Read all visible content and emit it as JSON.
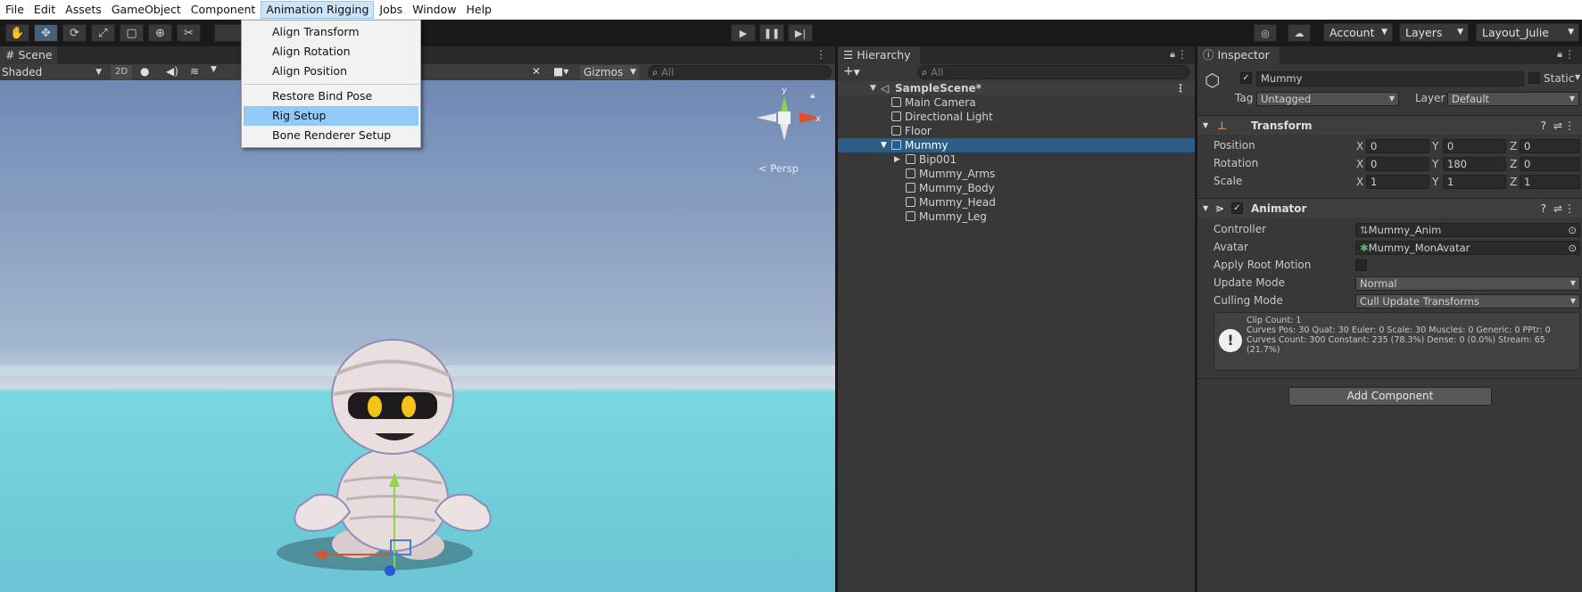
{
  "menubar": {
    "items": [
      "File",
      "Edit",
      "Assets",
      "GameObject",
      "Component",
      "Animation Rigging",
      "Jobs",
      "Window",
      "Help"
    ],
    "active_index": 5
  },
  "dropdown": {
    "items": [
      "Align Transform",
      "Align Rotation",
      "Align Position",
      "Restore Bind Pose",
      "Rig Setup",
      "Bone Renderer Setup"
    ],
    "highlighted": "Rig Setup"
  },
  "toolbar": {
    "tools": [
      "hand-icon",
      "move-icon",
      "rotate-icon",
      "scale-icon",
      "rect-icon",
      "transform-icon",
      "custom-tool-icon"
    ],
    "account_label": "Account",
    "layers_label": "Layers",
    "layout_label": "Layout_Julie"
  },
  "scene": {
    "tab_label": "Scene",
    "shading_mode": "Shaded",
    "mode_2d": "2D",
    "gizmos_label": "Gizmos",
    "search_placeholder": "All",
    "persp_label": "< Persp",
    "axis_x": "x",
    "axis_y": "y"
  },
  "hierarchy": {
    "tab_label": "Hierarchy",
    "search_placeholder": "All",
    "scene_name": "SampleScene*",
    "items": [
      {
        "label": "Main Camera",
        "depth": 1
      },
      {
        "label": "Directional Light",
        "depth": 1
      },
      {
        "label": "Floor",
        "depth": 1
      },
      {
        "label": "Mummy",
        "depth": 1,
        "selected": true,
        "expanded": true
      },
      {
        "label": "Bip001",
        "depth": 2,
        "collapsed": true
      },
      {
        "label": "Mummy_Arms",
        "depth": 2
      },
      {
        "label": "Mummy_Body",
        "depth": 2
      },
      {
        "label": "Mummy_Head",
        "depth": 2
      },
      {
        "label": "Mummy_Leg",
        "depth": 2
      }
    ]
  },
  "inspector": {
    "tab_label": "Inspector",
    "object_name": "Mummy",
    "static_label": "Static",
    "tag_label": "Tag",
    "tag_value": "Untagged",
    "layer_label": "Layer",
    "layer_value": "Default",
    "transform": {
      "title": "Transform",
      "position_label": "Position",
      "rotation_label": "Rotation",
      "scale_label": "Scale",
      "position": [
        "0",
        "0",
        "0"
      ],
      "rotation": [
        "0",
        "180",
        "0"
      ],
      "scale": [
        "1",
        "1",
        "1"
      ],
      "axes": [
        "X",
        "Y",
        "Z"
      ]
    },
    "animator": {
      "title": "Animator",
      "controller_label": "Controller",
      "controller_value": "Mummy_Anim",
      "avatar_label": "Avatar",
      "avatar_value": "Mummy_MonAvatar",
      "apply_root_motion_label": "Apply Root Motion",
      "update_mode_label": "Update Mode",
      "update_mode_value": "Normal",
      "culling_mode_label": "Culling Mode",
      "culling_mode_value": "Cull Update Transforms",
      "info_line1": "Clip Count: 1",
      "info_line2": "Curves Pos: 30 Quat: 30 Euler: 0 Scale: 30 Muscles: 0 Generic: 0 PPtr: 0",
      "info_line3": "Curves Count: 300 Constant: 235 (78.3%) Dense: 0 (0.0%) Stream: 65",
      "info_line4": "(21.7%)"
    },
    "add_component_label": "Add Component"
  },
  "colors": {
    "selection": "#2c5d87",
    "menu_highlight": "#91c9f7",
    "panel_bg": "#383838"
  }
}
